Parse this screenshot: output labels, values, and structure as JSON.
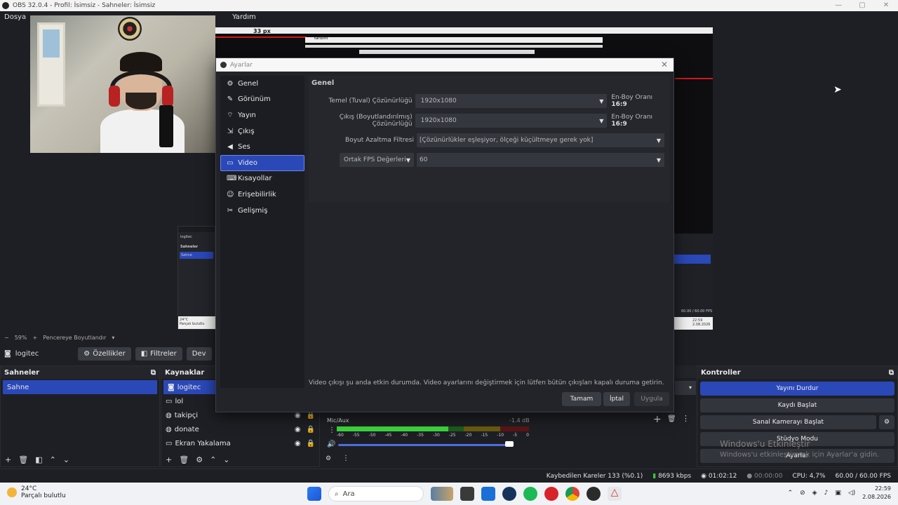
{
  "window": {
    "title": "OBS 32.0.4 - Profil: İsimsiz - Sahneler: İsimsiz",
    "controls": [
      "—",
      "▢",
      "✕"
    ]
  },
  "menu": {
    "first": "Dosya",
    "help": "Yardım"
  },
  "preview": {
    "zoom": "59%",
    "zoom_minus": "−",
    "zoom_plus": "+",
    "fit_label": "Pencereye Boyutlandır",
    "overlay_px": "33 px",
    "nested_help": "Yardım"
  },
  "source_toolbar": {
    "source_name": "logitec",
    "properties": "Özellikler",
    "filters": "Filtreler",
    "device": "Dev"
  },
  "scenes": {
    "title": "Sahneler",
    "items": [
      "Sahne"
    ]
  },
  "sources": {
    "title": "Kaynaklar",
    "items": [
      {
        "name": "logitec"
      },
      {
        "name": "lol"
      },
      {
        "name": "takipçi"
      },
      {
        "name": "donate"
      },
      {
        "name": "Ekran Yakalama"
      }
    ]
  },
  "mixer": {
    "track": "Mic/Aux",
    "db": "-1.4 dB",
    "scale": [
      "-60",
      "-55",
      "-50",
      "-45",
      "-40",
      "-35",
      "-30",
      "-25",
      "-20",
      "-15",
      "-10",
      "-5",
      "0"
    ],
    "level": 0.58
  },
  "controls": {
    "title": "Kontroller",
    "stop_stream": "Yayını Durdur",
    "start_record": "Kaydı Başlat",
    "virtual_cam": "Sanal Kamerayı Başlat",
    "studio_mode": "Stüdyo Modu",
    "settings": "Ayarlar"
  },
  "dialog": {
    "title": "Ayarlar",
    "nav": [
      {
        "label": "Genel",
        "icon": "gear-icon"
      },
      {
        "label": "Görünüm",
        "icon": "brush-icon"
      },
      {
        "label": "Yayın",
        "icon": "antenna-icon"
      },
      {
        "label": "Çıkış",
        "icon": "output-icon"
      },
      {
        "label": "Ses",
        "icon": "speaker-icon"
      },
      {
        "label": "Video",
        "icon": "monitor-icon"
      },
      {
        "label": "Kısayollar",
        "icon": "keyboard-icon"
      },
      {
        "label": "Erişebilirlik",
        "icon": "accessibility-icon"
      },
      {
        "label": "Gelişmiş",
        "icon": "tools-icon"
      }
    ],
    "active": "Video",
    "section": "Genel",
    "base_label": "Temel (Tuval) Çözünürlüğü",
    "base_value": "1920x1080",
    "output_label": "Çıkış (Boyutlandırılmış) Çözünürlüğü",
    "output_value": "1920x1080",
    "aspect_label": "En-Boy Oranı",
    "aspect_value": "16:9",
    "downscale_label": "Boyut Azaltma Filtresi",
    "downscale_value": "[Çözünürlükler eşleşiyor, ölçeği küçültmeye gerek yok]",
    "fps_type": "Ortak FPS Değerleri",
    "fps_value": "60",
    "note": "Video çıkışı şu anda etkin durumda. Video ayarlarını değiştirmek için lütfen bütün çıkışları kapalı duruma getirin.",
    "ok": "Tamam",
    "cancel": "İptal",
    "apply": "Uygula"
  },
  "status": {
    "dropped": "Kaybedilen Kareler 133 (%0.1)",
    "kbps": "8693 kbps",
    "stream_time": "01:02:12",
    "rec_time": "00:00:00",
    "cpu": "CPU: 4,7%",
    "fps": "60.00 / 60.00 FPS"
  },
  "watermark": {
    "title": "Windows'u Etkinleştir",
    "subtitle": "Windows'u etkinleştirmek için Ayarlar'a gidin."
  },
  "taskbar": {
    "temp": "24°C",
    "weather": "Parçalı bulutlu",
    "search": "Ara",
    "time": "22:59",
    "date": "2.08.2026"
  },
  "colors": {
    "accent": "#2a48b8",
    "panel": "#23242a",
    "background": "#1e1f24"
  }
}
